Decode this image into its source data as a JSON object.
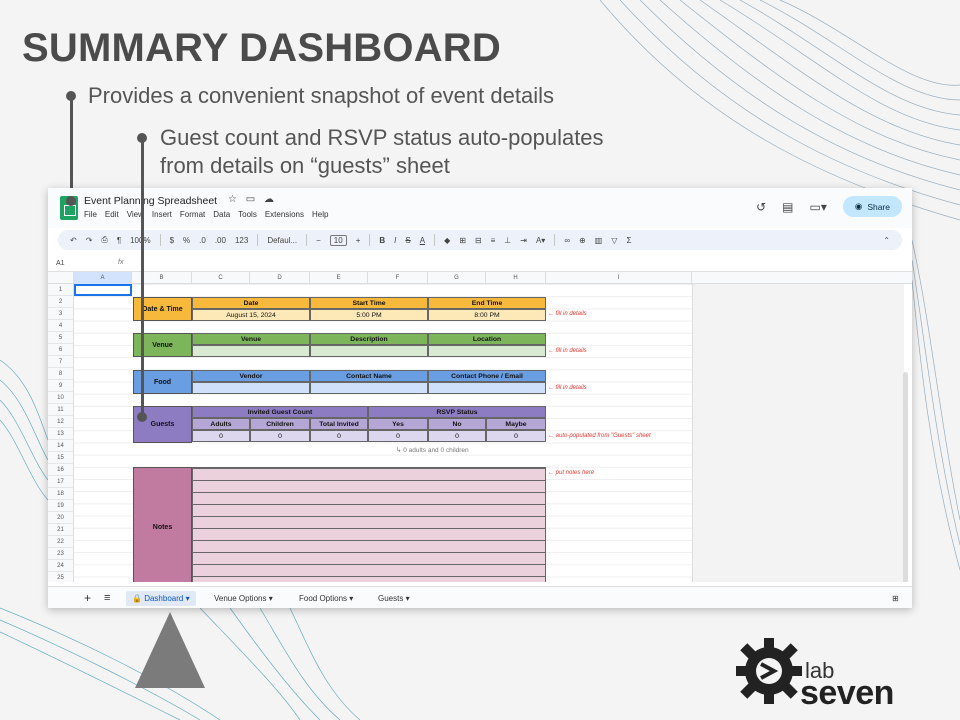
{
  "slide": {
    "title": "SUMMARY DASHBOARD",
    "bullet_1": "Provides a convenient snapshot of event details",
    "bullet_2_line1": "Guest count and RSVP status auto-populates",
    "bullet_2_line2": "from details on “guests” sheet"
  },
  "app": {
    "doc_title": "Event Planning Spreadsheet",
    "menus": [
      "File",
      "Edit",
      "View",
      "Insert",
      "Format",
      "Data",
      "Tools",
      "Extensions",
      "Help"
    ],
    "share_label": "Share",
    "toolbar": {
      "zoom": "100%",
      "currency": "$",
      "percent": "%",
      "decimals_less": ".0",
      "decimals_more": ".00",
      "number_format": "123",
      "font": "Defaul...",
      "font_size": "10"
    },
    "name_box": "A1",
    "fx": "fx"
  },
  "columns": [
    "A",
    "B",
    "C",
    "D",
    "E",
    "F",
    "G",
    "H",
    "I"
  ],
  "rows": [
    "1",
    "2",
    "3",
    "4",
    "5",
    "6",
    "7",
    "8",
    "9",
    "10",
    "11",
    "12",
    "13",
    "14",
    "15",
    "16",
    "17",
    "18",
    "19",
    "20",
    "21",
    "22",
    "23",
    "24",
    "25"
  ],
  "sections": {
    "datetime": {
      "label": "Date & Time",
      "h1": "Date",
      "h2": "Start Time",
      "h3": "End Time",
      "v1": "August 15, 2024",
      "v2": "5:00 PM",
      "v3": "8:00 PM",
      "note": "← fill in details"
    },
    "venue": {
      "label": "Venue",
      "h1": "Venue",
      "h2": "Description",
      "h3": "Location",
      "note": "← fill in details"
    },
    "food": {
      "label": "Food",
      "h1": "Vendor",
      "h2": "Contact Name",
      "h3": "Contact Phone / Email",
      "note": "← fill in details"
    },
    "guests": {
      "label": "Guests",
      "group1": "Invited Guest Count",
      "group2": "RSVP Status",
      "cols": [
        "Adults",
        "Children",
        "Total Invited",
        "Yes",
        "No",
        "Maybe"
      ],
      "vals": [
        "0",
        "0",
        "0",
        "0",
        "0",
        "0"
      ],
      "sub": "↳ 0 adults and 0 children",
      "note": "← auto-populated from \"Guests\" sheet"
    },
    "notes": {
      "label": "Notes",
      "note": "← put notes here"
    }
  },
  "tabs": [
    "Dashboard",
    "Venue Options",
    "Food Options",
    "Guests"
  ],
  "brand": {
    "top": "lab",
    "bottom": "seven"
  },
  "colors": {
    "datetime": "#f6b93b",
    "venue": "#7cb55a",
    "food": "#6a9ee3",
    "guests": "#8e7cc3",
    "notes": "#c27ba0"
  }
}
